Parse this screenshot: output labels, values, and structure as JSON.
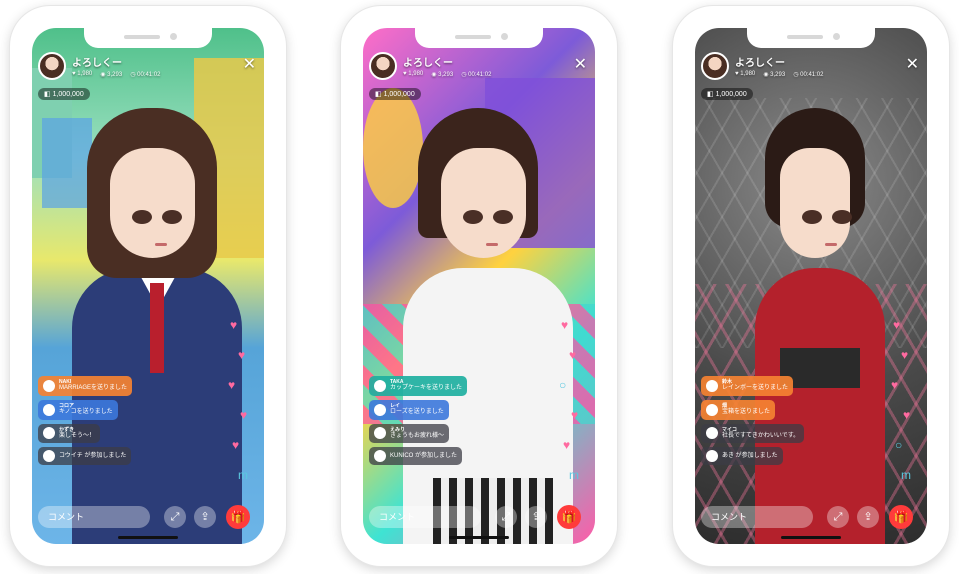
{
  "phones": [
    {
      "header": {
        "name": "よろしくー",
        "likes": "1,980",
        "viewers": "3,293",
        "time": "00:41:02"
      },
      "points": "1,000,000",
      "chat": [
        {
          "name": "NAKI",
          "text": "MARRIAGEを送りました",
          "style": "orange"
        },
        {
          "name": "コロア",
          "text": "キノコを送りました",
          "style": "blue"
        },
        {
          "name": "かずき",
          "text": "楽しそう～！",
          "style": "dark"
        },
        {
          "name": "",
          "text": "コウイチ が参加しました",
          "style": "dark"
        }
      ],
      "comment_placeholder": "コメント"
    },
    {
      "header": {
        "name": "よろしくー",
        "likes": "1,980",
        "viewers": "3,293",
        "time": "00:41:02"
      },
      "points": "1,000,000",
      "chat": [
        {
          "name": "TAKA",
          "text": "カップケーキを送りました",
          "style": "teal"
        },
        {
          "name": "レイ",
          "text": "ローズを送りました",
          "style": "blue"
        },
        {
          "name": "えみり",
          "text": "きょうもお疲れ様～",
          "style": "dark"
        },
        {
          "name": "",
          "text": "KUNICO が参加しました",
          "style": "dark"
        }
      ],
      "comment_placeholder": "コメント"
    },
    {
      "header": {
        "name": "よろしくー",
        "likes": "1,980",
        "viewers": "3,293",
        "time": "00:41:02"
      },
      "points": "1,000,000",
      "chat": [
        {
          "name": "鈴木",
          "text": "レインボーを送りました",
          "style": "orange"
        },
        {
          "name": "畑",
          "text": "宝箱を送りました",
          "style": "orange"
        },
        {
          "name": "マイコ",
          "text": "社長ですてきかわいいです。",
          "style": "dark"
        },
        {
          "name": "",
          "text": "あき が参加しました",
          "style": "dark"
        }
      ],
      "comment_placeholder": "コメント"
    }
  ]
}
